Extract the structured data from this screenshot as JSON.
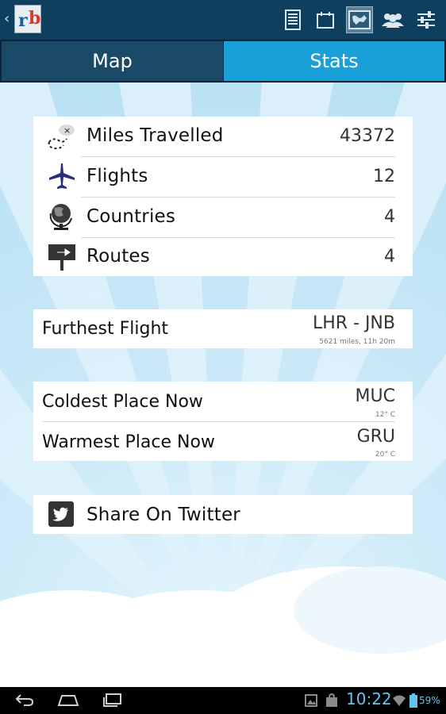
{
  "app": {
    "logo_letters": [
      "r",
      "b"
    ],
    "icons": [
      "back-chevron-icon",
      "list-icon",
      "calendar-icon",
      "map-icon",
      "people-icon",
      "settings-sliders-icon"
    ]
  },
  "tabs": [
    {
      "label": "Map",
      "selected": false
    },
    {
      "label": "Stats",
      "selected": true
    }
  ],
  "stats": {
    "rows": [
      {
        "label": "Miles Travelled",
        "value": "43372",
        "icon": "route-map-icon"
      },
      {
        "label": "Flights",
        "value": "12",
        "icon": "airplane-icon"
      },
      {
        "label": "Countries",
        "value": "4",
        "icon": "globe-icon"
      },
      {
        "label": "Routes",
        "value": "4",
        "icon": "signpost-icon"
      }
    ]
  },
  "furthest": {
    "label": "Furthest Flight",
    "value": "LHR - JNB",
    "detail": "5621 miles, 11h 20m"
  },
  "weather": {
    "coldest": {
      "label": "Coldest Place Now",
      "value": "MUC",
      "detail": "12° C"
    },
    "warmest": {
      "label": "Warmest Place Now",
      "value": "GRU",
      "detail": "20° C"
    }
  },
  "share": {
    "label": "Share On Twitter",
    "icon": "twitter-icon"
  },
  "system": {
    "time": "10:22",
    "battery": "59%"
  },
  "colors": {
    "actionbar": "#0f3f5e",
    "tab_selected": "#1aa0d8",
    "tab_unselected": "#1a4a68",
    "clock": "#5fc6f1"
  }
}
